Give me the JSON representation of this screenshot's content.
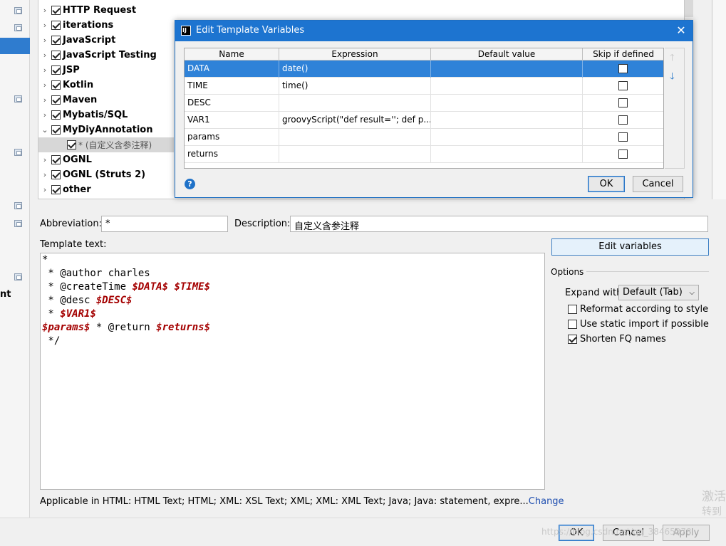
{
  "left_strip": {
    "partial_text": "nt"
  },
  "tree": {
    "items": [
      {
        "label": "HTTP Request",
        "expanded": false,
        "checked": true
      },
      {
        "label": "iterations",
        "expanded": false,
        "checked": true
      },
      {
        "label": "JavaScript",
        "expanded": false,
        "checked": true
      },
      {
        "label": "JavaScript Testing",
        "expanded": false,
        "checked": true
      },
      {
        "label": "JSP",
        "expanded": false,
        "checked": true
      },
      {
        "label": "Kotlin",
        "expanded": false,
        "checked": true
      },
      {
        "label": "Maven",
        "expanded": false,
        "checked": true
      },
      {
        "label": "Mybatis/SQL",
        "expanded": false,
        "checked": true
      },
      {
        "label": "MyDiyAnnotation",
        "expanded": true,
        "checked": true
      },
      {
        "label": "OGNL",
        "expanded": false,
        "checked": true
      },
      {
        "label": "OGNL (Struts 2)",
        "expanded": false,
        "checked": true
      },
      {
        "label": "other",
        "expanded": false,
        "checked": true
      }
    ],
    "child": {
      "label": "* (自定义含参注释)",
      "checked": true
    },
    "expand_arrow": "›",
    "collapse_arrow": "⌄"
  },
  "form": {
    "abbreviation_label": "Abbreviation:",
    "abbreviation_value": "*",
    "description_label": "Description:",
    "description_value": "自定义含参注释",
    "template_text_label": "Template text:",
    "edit_variables_label": "Edit variables"
  },
  "template": {
    "lines": [
      [
        {
          "t": "*"
        }
      ],
      [
        {
          "t": " * @author charles"
        }
      ],
      [
        {
          "t": " * @createTime "
        },
        {
          "t": "$DATA$",
          "v": true
        },
        {
          "t": " "
        },
        {
          "t": "$TIME$",
          "v": true
        }
      ],
      [
        {
          "t": " * @desc "
        },
        {
          "t": "$DESC$",
          "v": true
        }
      ],
      [
        {
          "t": " * "
        },
        {
          "t": "$VAR1$",
          "v": true
        }
      ],
      [
        {
          "t": "$params$",
          "v": true
        },
        {
          "t": " * @return "
        },
        {
          "t": "$returns$",
          "v": true
        }
      ],
      [
        {
          "t": " */"
        }
      ]
    ]
  },
  "options": {
    "title": "Options",
    "expand_with_label": "Expand with",
    "expand_with_value": "Default (Tab)",
    "reformat_label": "Reformat according to style",
    "reformat_checked": false,
    "static_import_label": "Use static import if possible",
    "static_import_checked": false,
    "shorten_fq_label": "Shorten FQ names",
    "shorten_fq_checked": true
  },
  "applicable": {
    "text": "Applicable in HTML: HTML Text; HTML; XML: XSL Text; XML; XML: XML Text; Java; Java: statement, expre...",
    "change_link": "Change"
  },
  "bottom": {
    "ok_label": "OK",
    "cancel_label": "Cancel",
    "apply_label": "Apply"
  },
  "watermark": {
    "activate_line1": "激活",
    "activate_line2": "转到",
    "url": "https://blog.csdn.net/qq_38465378"
  },
  "dialog": {
    "title": "Edit Template Variables",
    "icon_text": "IJ",
    "close_glyph": "✕",
    "columns": [
      "Name",
      "Expression",
      "Default value",
      "Skip if defined"
    ],
    "rows": [
      {
        "name": "DATA",
        "expression": "date()",
        "default": "",
        "skip": false,
        "selected": true
      },
      {
        "name": "TIME",
        "expression": "time()",
        "default": "",
        "skip": false,
        "selected": false
      },
      {
        "name": "DESC",
        "expression": "",
        "default": "",
        "skip": false,
        "selected": false
      },
      {
        "name": "VAR1",
        "expression": "groovyScript(\"def result=''; def p...",
        "default": "",
        "skip": false,
        "selected": false
      },
      {
        "name": "params",
        "expression": "",
        "default": "",
        "skip": false,
        "selected": false
      },
      {
        "name": "returns",
        "expression": "",
        "default": "",
        "skip": false,
        "selected": false
      }
    ],
    "move_up_glyph": "🡑",
    "move_down_glyph": "🡓",
    "help_glyph": "?",
    "ok_label": "OK",
    "cancel_label": "Cancel",
    "colors": {
      "title_bar": "#1d74d0",
      "selected_row": "#2f82d8",
      "accent": "#1f72c8"
    }
  },
  "colors": {
    "template_variable": "#a40000",
    "link": "#1f4fb0"
  }
}
